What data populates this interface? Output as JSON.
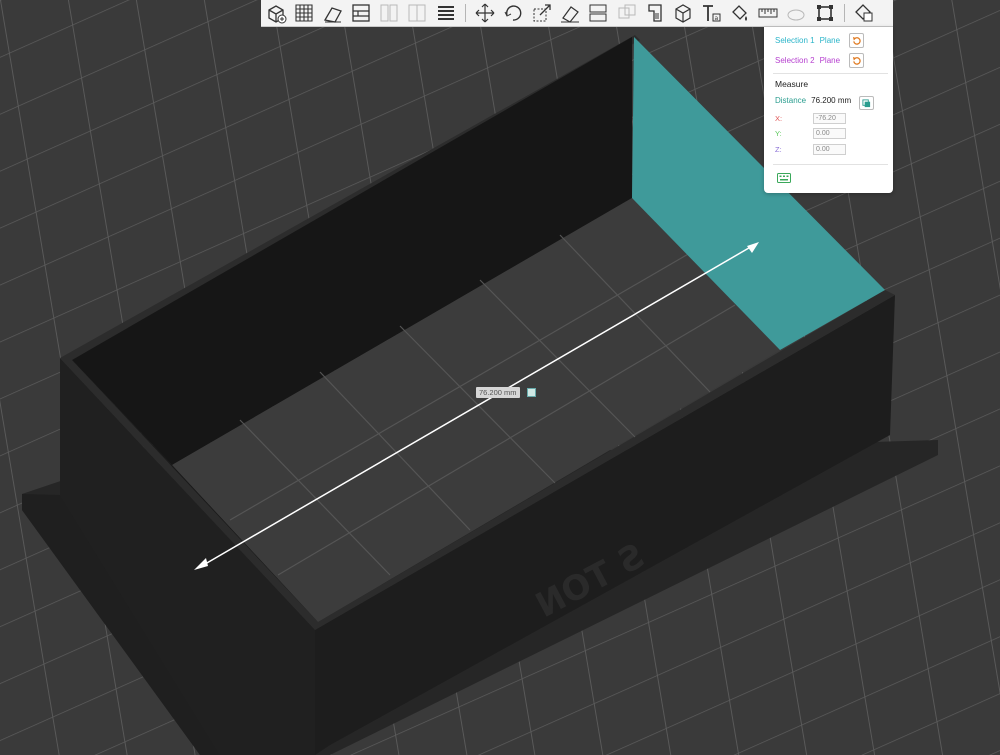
{
  "toolbar": {
    "tools": [
      {
        "icon": "add-cube-icon",
        "enabled": true
      },
      {
        "icon": "grid-arrange-icon",
        "enabled": true
      },
      {
        "icon": "orient-object-icon",
        "enabled": true
      },
      {
        "icon": "layout-panel-icon",
        "enabled": true
      },
      {
        "icon": "split-objects-icon",
        "enabled": false
      },
      {
        "icon": "split-parts-icon",
        "enabled": false
      },
      {
        "icon": "layers-icon",
        "enabled": true
      },
      {
        "icon": "move-icon",
        "enabled": true
      },
      {
        "icon": "rotate-icon",
        "enabled": true
      },
      {
        "icon": "scale-icon",
        "enabled": true
      },
      {
        "icon": "lay-on-face-icon",
        "enabled": true
      },
      {
        "icon": "cut-icon",
        "enabled": true
      },
      {
        "icon": "mesh-boolean-icon",
        "enabled": false
      },
      {
        "icon": "support-paint-icon",
        "enabled": true
      },
      {
        "icon": "seam-paint-icon",
        "enabled": true
      },
      {
        "icon": "text-emboss-icon",
        "enabled": true
      },
      {
        "icon": "color-paint-icon",
        "enabled": true
      },
      {
        "icon": "measure-ruler-icon",
        "enabled": true
      },
      {
        "icon": "assembly-icon",
        "enabled": false
      },
      {
        "icon": "fit-selection-icon",
        "enabled": true
      },
      {
        "icon": "assembly-view-icon",
        "enabled": true
      }
    ]
  },
  "measure_panel": {
    "selection1_label": "Selection 1",
    "selection1_value": "Plane",
    "selection2_label": "Selection 2",
    "selection2_value": "Plane",
    "title": "Measure",
    "distance_label": "Distance",
    "distance_value": "76.200 mm",
    "x_label": "X:",
    "x_value": "-76.20",
    "y_label": "Y:",
    "y_value": "0.00",
    "z_label": "Z:",
    "z_value": "0.00",
    "colors": {
      "selection1": "#2bb5c9",
      "selection2": "#b63fcf",
      "distance": "#2a9d8f",
      "x": "#e05555",
      "y": "#5cc85c",
      "z": "#8a6fd6"
    }
  },
  "viewport": {
    "distance_tag": "76.200 mm",
    "embossed_text": "S TON",
    "colors": {
      "bed": "#3a3a3a",
      "grid": "#5a5a5a",
      "model": "#1c1c1c",
      "selected_face": "#3f9a9a"
    }
  }
}
